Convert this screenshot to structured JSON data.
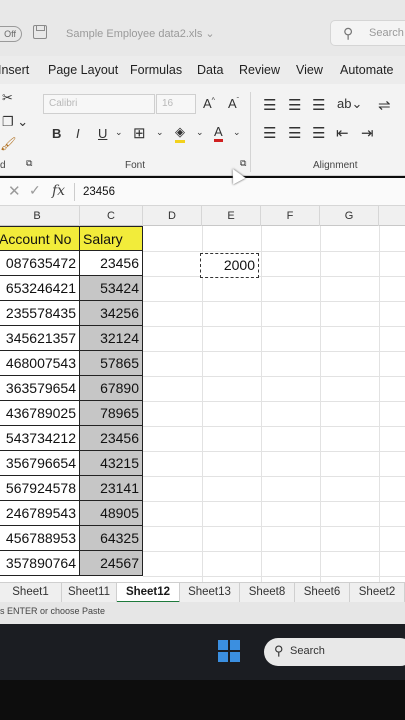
{
  "titlebar": {
    "autosave_label": "Off",
    "document_title": "Sample Employee data2.xls",
    "search_placeholder": "Search"
  },
  "menu": [
    "Insert",
    "Page Layout",
    "Formulas",
    "Data",
    "Review",
    "View",
    "Automate"
  ],
  "ribbon": {
    "font_name": "Calibri",
    "font_size": "16",
    "groups": {
      "font": "Font",
      "alignment": "Alignment",
      "clipboard_fragment": "d"
    }
  },
  "formula_bar": {
    "value": "23456"
  },
  "columns": [
    "B",
    "C",
    "D",
    "E",
    "F",
    "G"
  ],
  "table": {
    "headers": [
      "Account No",
      "Salary"
    ],
    "rows": [
      [
        "087635472",
        "23456"
      ],
      [
        "653246421",
        "53424"
      ],
      [
        "235578435",
        "34256"
      ],
      [
        "345621357",
        "32124"
      ],
      [
        "468007543",
        "57865"
      ],
      [
        "363579654",
        "67890"
      ],
      [
        "436789025",
        "78965"
      ],
      [
        "543734212",
        "23456"
      ],
      [
        "356796654",
        "43215"
      ],
      [
        "567924578",
        "23141"
      ],
      [
        "246789543",
        "48905"
      ],
      [
        "456788953",
        "64325"
      ],
      [
        "357890764",
        "24567"
      ]
    ]
  },
  "copied_cell": {
    "value": "2000"
  },
  "sheet_tabs": [
    "Sheet1",
    "Sheet11",
    "Sheet12",
    "Sheet13",
    "Sheet8",
    "Sheet6",
    "Sheet2"
  ],
  "active_sheet": "Sheet12",
  "status": {
    "message": "s ENTER or choose Paste"
  },
  "taskbar": {
    "search_text": "Search"
  }
}
